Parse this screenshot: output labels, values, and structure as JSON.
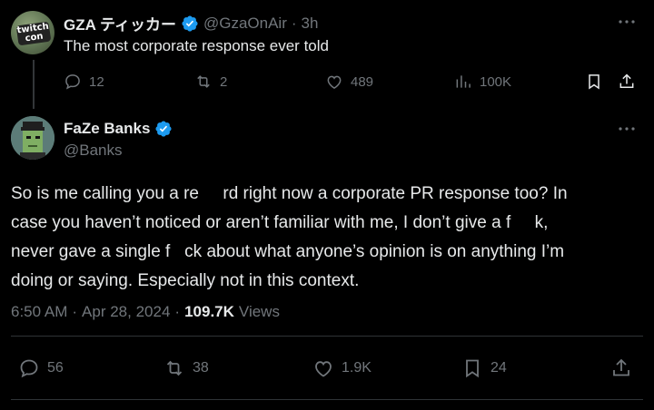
{
  "parent_tweet": {
    "display_name": "GZA ティッカー",
    "handle": "@GzaOnAir",
    "separator": "·",
    "time": "3h",
    "text": "The most corporate response ever told",
    "avatar_text": "twitch con",
    "actions": {
      "replies": "12",
      "reposts": "2",
      "likes": "489",
      "views": "100K"
    }
  },
  "main_tweet": {
    "display_name": "FaZe Banks",
    "handle": "@Banks",
    "body_lines": [
      "So is me calling you a re     rd right now a corporate PR response too? In",
      "case you haven’t noticed or aren’t familiar with me, I don’t give a f     k,",
      "never gave a single f   ck about what anyone’s opinion is on anything I’m",
      "doing or saying. Especially not in this context."
    ],
    "time": "6:50 AM",
    "date": "Apr 28, 2024",
    "separator": "·",
    "views_count": "109.7K",
    "views_label": "Views",
    "actions": {
      "replies": "56",
      "reposts": "38",
      "likes": "1.9K",
      "bookmarks": "24"
    }
  },
  "colors": {
    "background": "#000000",
    "text": "#e7e9ea",
    "muted": "#71767b",
    "verified": "#1d9bf0",
    "divider": "#2f3336"
  }
}
